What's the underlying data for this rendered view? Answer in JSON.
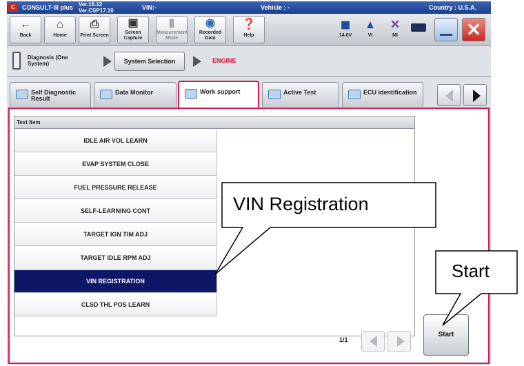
{
  "titlebar": {
    "app_name": "CONSULT-III plus",
    "ver1": "Ver.16.12",
    "ver2": "Ver.CSP17.10",
    "vin": "VIN:-",
    "vehicle": "Vehicle : -",
    "country": "Country : U.S.A."
  },
  "toolbar": {
    "back": "Back",
    "home": "Home",
    "print_screen": "Print Screen",
    "screen_capture": "Screen Capture",
    "measurement_mode": "Measurement Mode",
    "recorded_data": "Recorded Data",
    "help": "Help",
    "voltage": "14.0V",
    "vi": "VI",
    "mi": "MI"
  },
  "breadcrumb": {
    "step1": "Diagnosis (One System)",
    "step2": "System Selection",
    "step3": "ENGINE"
  },
  "tabs": [
    {
      "label": "Self Diagnostic Result",
      "active": false
    },
    {
      "label": "Data Monitor",
      "active": false
    },
    {
      "label": "Work support",
      "active": true
    },
    {
      "label": "Active Test",
      "active": false
    },
    {
      "label": "ECU identification",
      "active": false
    }
  ],
  "grid": {
    "header": "Test Item",
    "items": [
      "IDLE AIR VOL LEARN",
      "EVAP SYSTEM CLOSE",
      "FUEL PRESSURE RELEASE",
      "SELF-LEARNING CONT",
      "TARGET IGN TIM ADJ",
      "TARGET IDLE RPM ADJ",
      "VIN REGISTRATION",
      "CLSD THL POS LEARN"
    ],
    "selected_index": 6
  },
  "pager": {
    "text": "1/1"
  },
  "start_button": "Start",
  "callouts": {
    "vin": "VIN Registration",
    "start": "Start"
  },
  "colors": {
    "selected_row": "#0e1666",
    "active_tab_border": "#d81b4e",
    "engine_label": "#d0103a",
    "close_button": "#d9362b"
  }
}
